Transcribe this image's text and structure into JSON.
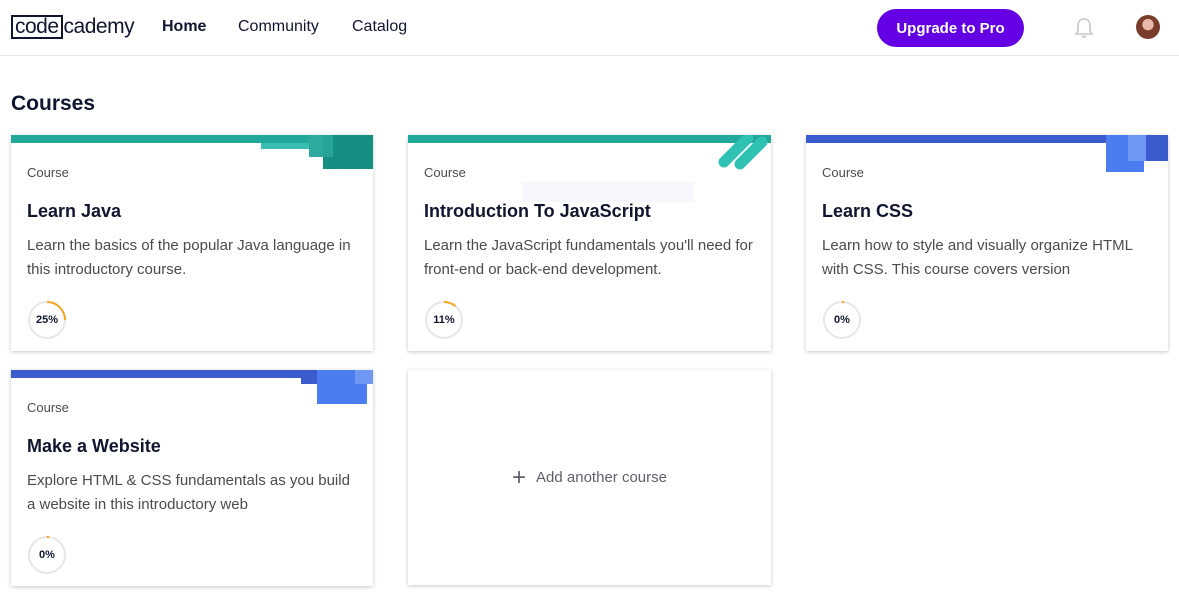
{
  "header": {
    "logo_code": "code",
    "logo_cademy": "cademy",
    "nav": [
      {
        "label": "Home",
        "active": true
      },
      {
        "label": "Community",
        "active": false
      },
      {
        "label": "Catalog",
        "active": false
      }
    ],
    "upgrade_label": "Upgrade to Pro"
  },
  "section_title": "Courses",
  "courses": [
    {
      "kind": "Course",
      "title": "Learn Java",
      "description": "Learn the basics of the popular Java language in this introductory course.",
      "progress_label": "25%",
      "progress": 0.25,
      "accent": "#21a89a"
    },
    {
      "kind": "Course",
      "title": "Introduction To JavaScript",
      "description": "Learn the JavaScript fundamentals you'll need for front-end or back-end development.",
      "progress_label": "11%",
      "progress": 0.11,
      "accent": "#21a89a"
    },
    {
      "kind": "Course",
      "title": "Learn CSS",
      "description": "Learn how to style and visually organize HTML with CSS. This course covers version",
      "progress_label": "0%",
      "progress": 0.0,
      "accent": "#3a5ccc"
    },
    {
      "kind": "Course",
      "title": "Make a Website",
      "description": "Explore HTML & CSS fundamentals as you build a website in this introductory web",
      "progress_label": "0%",
      "progress": 0.0,
      "accent": "#3a5ccc"
    }
  ],
  "add_course_label": "Add another course",
  "colors": {
    "brand_purple": "#6400e4",
    "teal": "#21a89a",
    "blue": "#3a5ccc",
    "progress_orange": "#f5a623"
  }
}
